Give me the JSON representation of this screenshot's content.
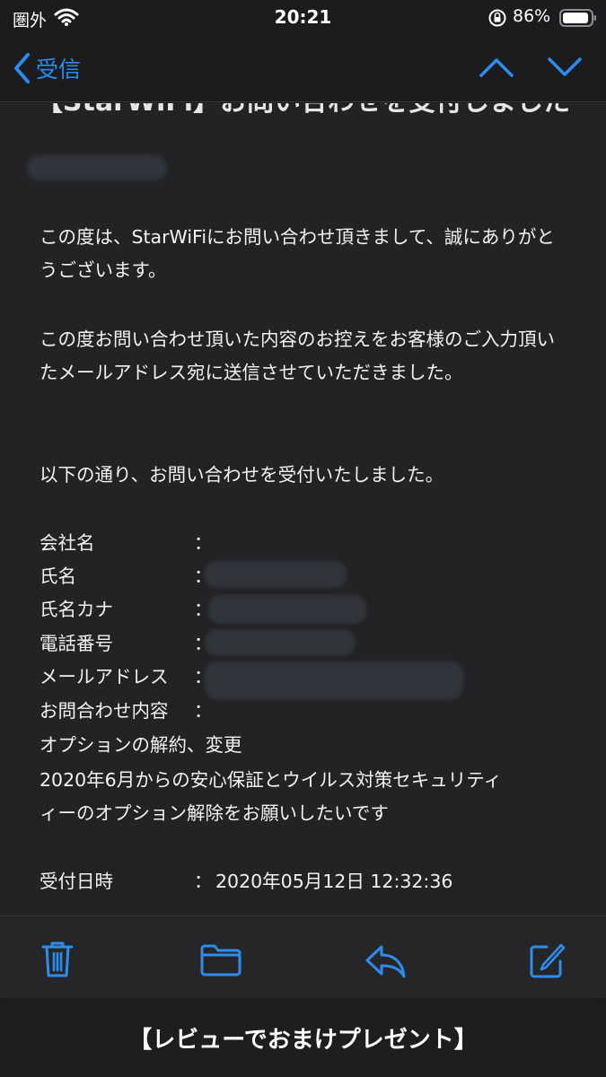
{
  "status_bar": {
    "carrier": "圏外",
    "time": "20:21",
    "battery_percent": "86%"
  },
  "nav": {
    "back_label": "受信"
  },
  "email": {
    "subject_clipped": "【StarWiFi】お問い合わせを受付しました",
    "paragraphs": [
      "この度は、StarWiFiにお問い合わせ頂きまして、誠にありがとうございます。",
      "この度お問い合わせ頂いた内容のお控えをお客様のご入力頂いたメールアドレス宛に送信させていただきました。",
      "以下の通り、お問い合わせを受付いたしました。"
    ],
    "fields": [
      {
        "label": "会社名",
        "colon": "：",
        "value": ""
      },
      {
        "label": "氏名",
        "colon": "：",
        "value": ""
      },
      {
        "label": "氏名カナ",
        "colon": "：",
        "value": ""
      },
      {
        "label": "電話番号",
        "colon": "：",
        "value": ""
      },
      {
        "label": "メールアドレス",
        "colon": "：",
        "value": ""
      },
      {
        "label": "お問合わせ内容",
        "colon": "：",
        "value": ""
      }
    ],
    "inquiry_lines": [
      "オプションの解約、変更",
      "2020年6月からの安心保証とウイルス対策セキュリティ",
      "ィーのオプション解除をお願いしたいです"
    ],
    "received": {
      "label": "受付日時",
      "colon": "：",
      "value": "2020年05月12日 12:32:36"
    }
  },
  "banner": {
    "text": "【レビューでおまけプレゼント】"
  },
  "colors": {
    "accent": "#2d8cf0",
    "background": "#1c1c1e",
    "content_bg": "#232325"
  },
  "icons": {
    "toolbar": [
      "trash-icon",
      "folder-icon",
      "reply-icon",
      "compose-icon"
    ]
  }
}
